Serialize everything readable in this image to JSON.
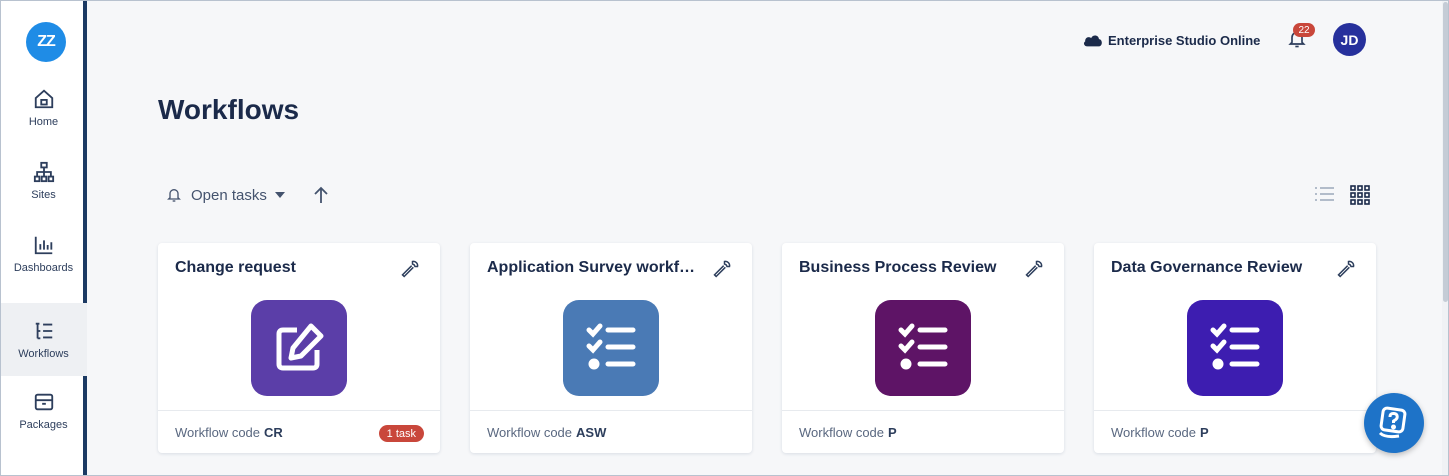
{
  "sidebar": {
    "logo_text": "ZZ",
    "items": [
      {
        "label": "Home",
        "icon": "home-icon"
      },
      {
        "label": "Sites",
        "icon": "sitemap-icon"
      },
      {
        "label": "Dashboards",
        "icon": "bar-chart-icon"
      },
      {
        "label": "Workflows",
        "icon": "workflow-list-icon",
        "active": true
      },
      {
        "label": "Packages",
        "icon": "package-icon"
      }
    ]
  },
  "header": {
    "environment": "Enterprise Studio Online",
    "environment_icon": "cloud-icon",
    "notification_count": "22",
    "avatar_initials": "JD"
  },
  "page": {
    "title": "Workflows",
    "filter_label": "Open tasks",
    "filter_icon": "bell-icon",
    "sort_icon": "arrow-up-icon",
    "view_modes": [
      "list-view-icon",
      "grid-view-icon"
    ],
    "active_view": "grid"
  },
  "footer_label": "Workflow code",
  "cards": [
    {
      "title": "Change request",
      "code": "CR",
      "icon": "edit-icon",
      "color": "#5b3ea8",
      "badge": "1 task"
    },
    {
      "title": "Application Survey workf…",
      "code": "ASW",
      "icon": "checklist-icon",
      "color": "#4a7ab5",
      "badge": ""
    },
    {
      "title": "Business Process Review",
      "code": "P",
      "icon": "checklist-icon",
      "color": "#5e1466",
      "badge": ""
    },
    {
      "title": "Data Governance Review",
      "code": "P",
      "icon": "checklist-icon",
      "color": "#3d1db0",
      "badge": ""
    }
  ],
  "colors": {
    "accent": "#1f8ce6",
    "sidebar_border": "#1c3a63",
    "badge": "#c9473b",
    "avatar": "#26309c"
  }
}
